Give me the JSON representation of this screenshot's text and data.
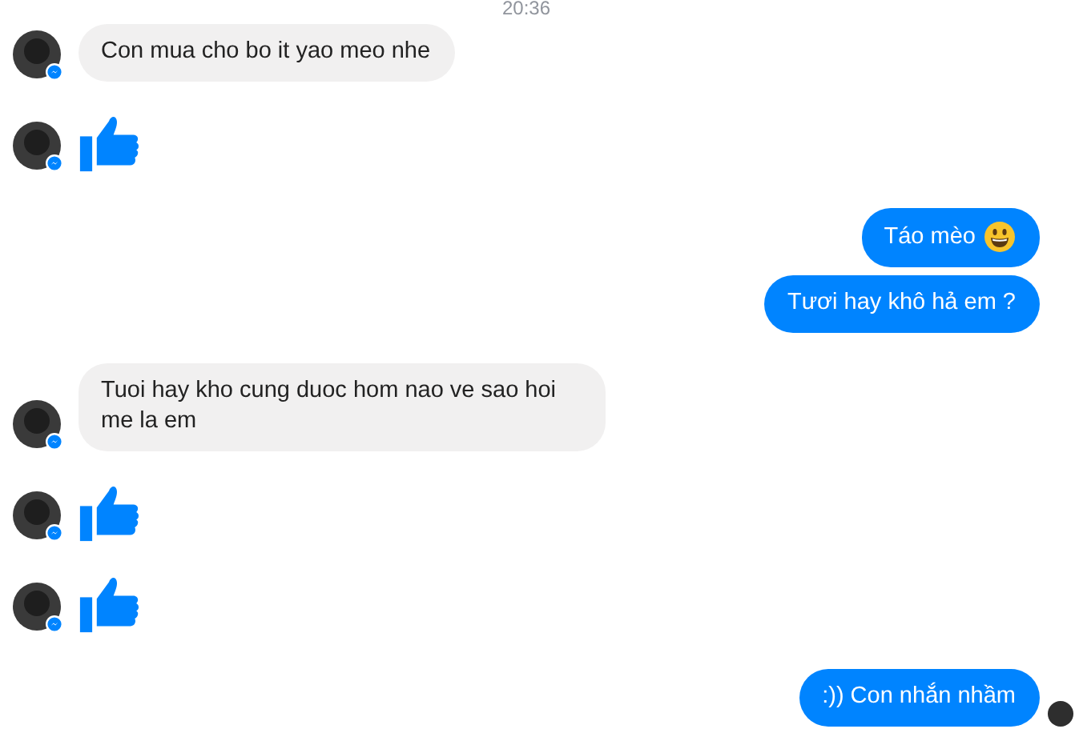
{
  "timestamp": "20:36",
  "messages": [
    {
      "kind": "incoming_text",
      "text": "Con mua cho bo it yao meo nhe"
    },
    {
      "kind": "incoming_like"
    },
    {
      "kind": "outgoing_text",
      "text": "Táo mèo",
      "emoji": true,
      "seen": false
    },
    {
      "kind": "outgoing_text",
      "text": "Tươi hay khô hả em ?",
      "emoji": false,
      "seen": false
    },
    {
      "kind": "incoming_text",
      "text": "Tuoi hay kho cung duoc hom nao ve sao hoi me la em"
    },
    {
      "kind": "incoming_like"
    },
    {
      "kind": "incoming_like"
    },
    {
      "kind": "outgoing_text",
      "text": ":)) Con nhắn nhầm",
      "emoji": false,
      "seen": true
    }
  ]
}
